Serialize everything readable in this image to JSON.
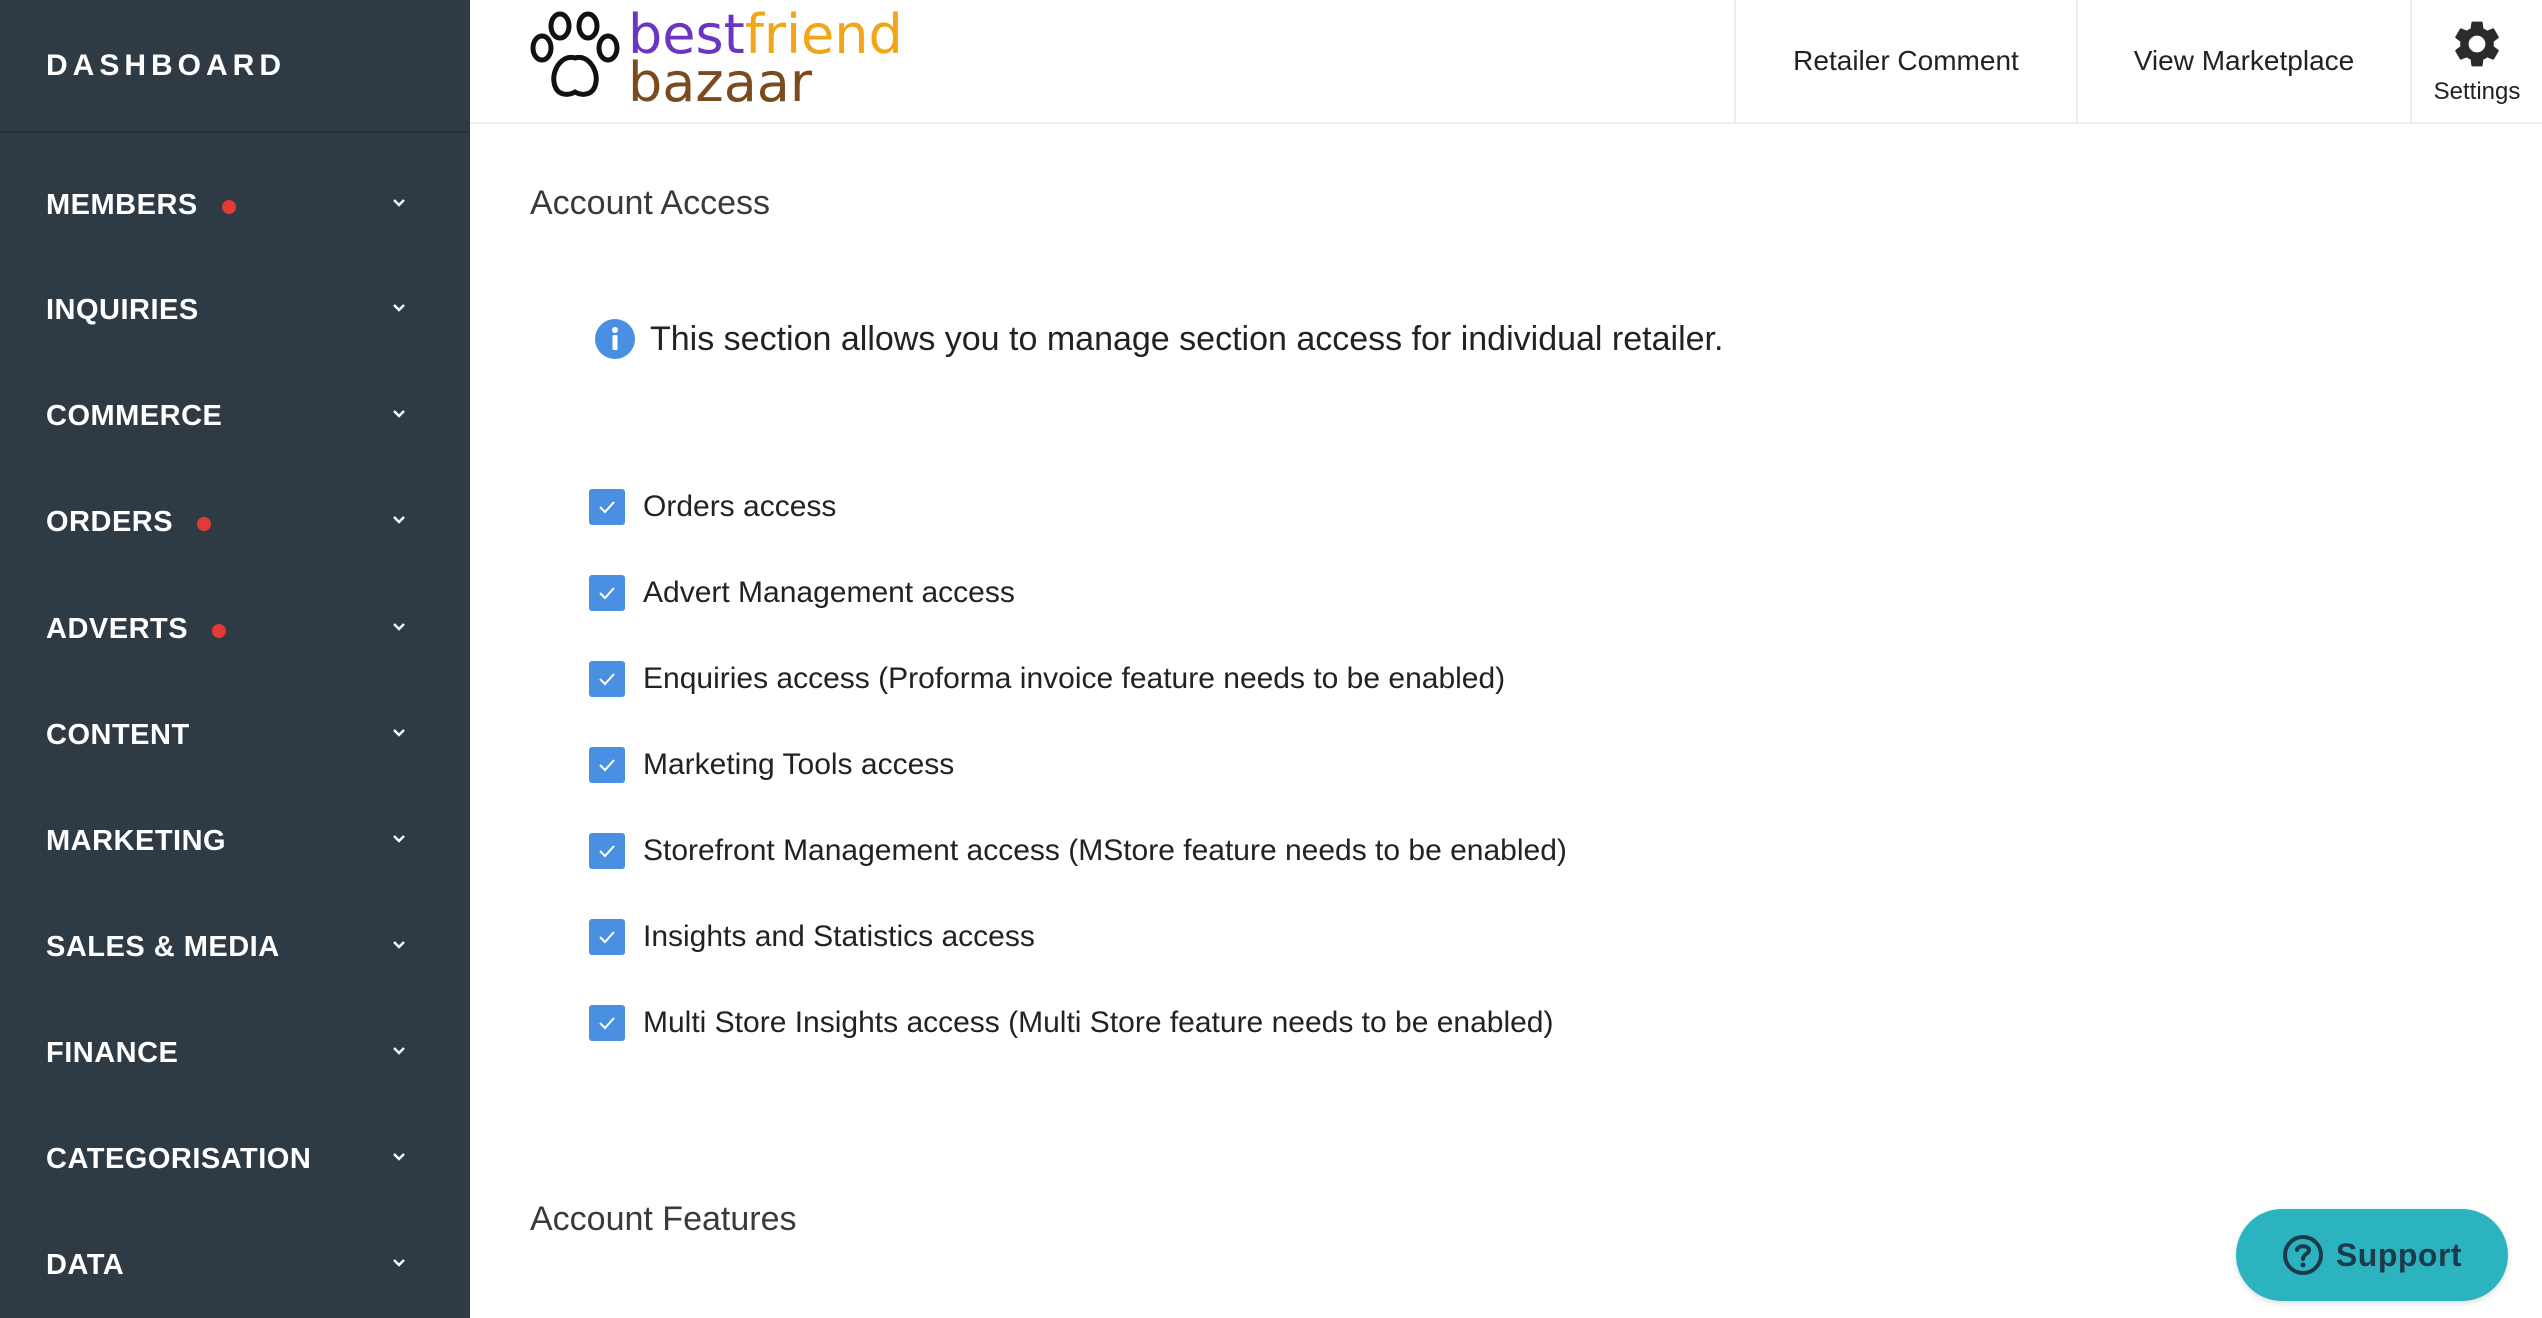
{
  "sidebar": {
    "title": "DASHBOARD",
    "items": [
      {
        "label": "MEMBERS",
        "dot": true
      },
      {
        "label": "INQUIRIES",
        "dot": false
      },
      {
        "label": "COMMERCE",
        "dot": false
      },
      {
        "label": "ORDERS",
        "dot": true
      },
      {
        "label": "ADVERTS",
        "dot": true
      },
      {
        "label": "CONTENT",
        "dot": false
      },
      {
        "label": "MARKETING",
        "dot": false
      },
      {
        "label": "SALES & MEDIA",
        "dot": false
      },
      {
        "label": "FINANCE",
        "dot": false
      },
      {
        "label": "CATEGORISATION",
        "dot": false
      },
      {
        "label": "DATA",
        "dot": false
      }
    ]
  },
  "logo": {
    "part1": "best",
    "part2": "friend",
    "part3": "bazaar"
  },
  "topbar": {
    "retailer_comment": "Retailer Comment",
    "view_marketplace": "View Marketplace",
    "settings": "Settings"
  },
  "account_access": {
    "heading": "Account Access",
    "info": "This section allows you to manage section access for individual retailer.",
    "options": [
      {
        "label": "Orders access",
        "checked": true
      },
      {
        "label": "Advert Management access",
        "checked": true
      },
      {
        "label": "Enquiries access (Proforma invoice feature needs to be enabled)",
        "checked": true
      },
      {
        "label": "Marketing Tools access",
        "checked": true
      },
      {
        "label": "Storefront Management access (MStore feature needs to be enabled)",
        "checked": true
      },
      {
        "label": "Insights and Statistics access",
        "checked": true
      },
      {
        "label": "Multi Store Insights access (Multi Store feature needs to be enabled)",
        "checked": true
      }
    ]
  },
  "account_features": {
    "heading": "Account Features"
  },
  "support": {
    "label": "Support"
  },
  "colors": {
    "sidebar_bg": "#2e3a44",
    "dot_red": "#e53935",
    "checkbox_blue": "#4a90e2",
    "support_teal": "#2bb3c0",
    "info_blue": "#4a90e2"
  }
}
